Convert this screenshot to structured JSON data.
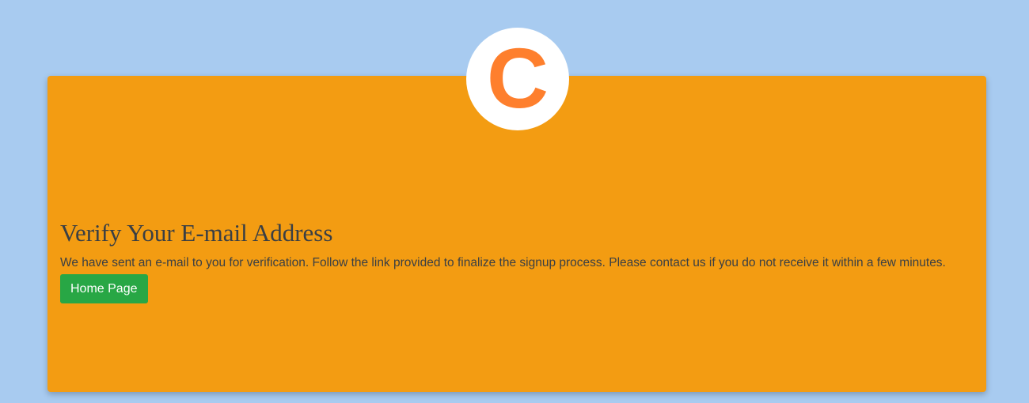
{
  "logo": {
    "letter": "C",
    "letter_color": "#fe7f2d",
    "background_color": "#ffffff"
  },
  "page": {
    "background_color": "#a8cbf0",
    "card_color": "#f39c12"
  },
  "verify": {
    "title": "Verify Your E-mail Address",
    "message": "We have sent an e-mail to you for verification. Follow the link provided to finalize the signup process. Please contact us if you do not receive it within a few minutes.",
    "home_button_label": "Home Page",
    "home_button_color": "#28a745"
  }
}
